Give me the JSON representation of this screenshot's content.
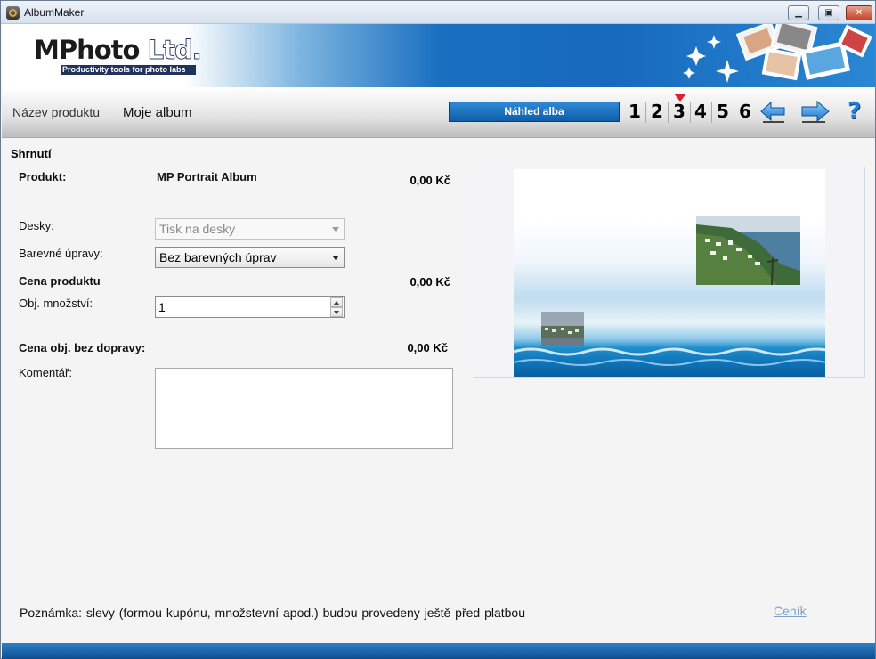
{
  "window": {
    "title": "AlbumMaker"
  },
  "brand": {
    "name_main": "MPhoto",
    "name_suffix": " Ltd.",
    "tagline": "Productivity tools for photo labs"
  },
  "toolbar": {
    "product_name_label": "Název produktu",
    "product_name_value": "Moje album",
    "preview_tab": "Náhled alba",
    "steps": [
      "1",
      "2",
      "3",
      "4",
      "5",
      "6"
    ],
    "current_step": "3",
    "help": "?"
  },
  "summary": {
    "title": "Shrnutí",
    "product_label": "Produkt:",
    "product_value": "MP Portrait Album",
    "product_price": "0,00 Kč",
    "covers_label": "Desky:",
    "covers_value": "Tisk na desky",
    "color_label": "Barevné úpravy:",
    "color_value": "Bez barevných úprav",
    "product_cost_label": "Cena produktu",
    "product_cost_value": "0,00 Kč",
    "quantity_label": "Obj. množství:",
    "quantity_value": "1",
    "total_label": "Cena obj. bez dopravy:",
    "total_value": "0,00 Kč",
    "comment_label": "Komentář:",
    "comment_value": ""
  },
  "footer": {
    "note": "Poznámka: slevy (formou kupónu, množstevní apod.) budou provedeny ještě před platbou",
    "pricelist_link": "Ceník"
  },
  "colors": {
    "accent": "#1769bd",
    "marker": "#e0202a",
    "link": "#7f9fc9"
  }
}
